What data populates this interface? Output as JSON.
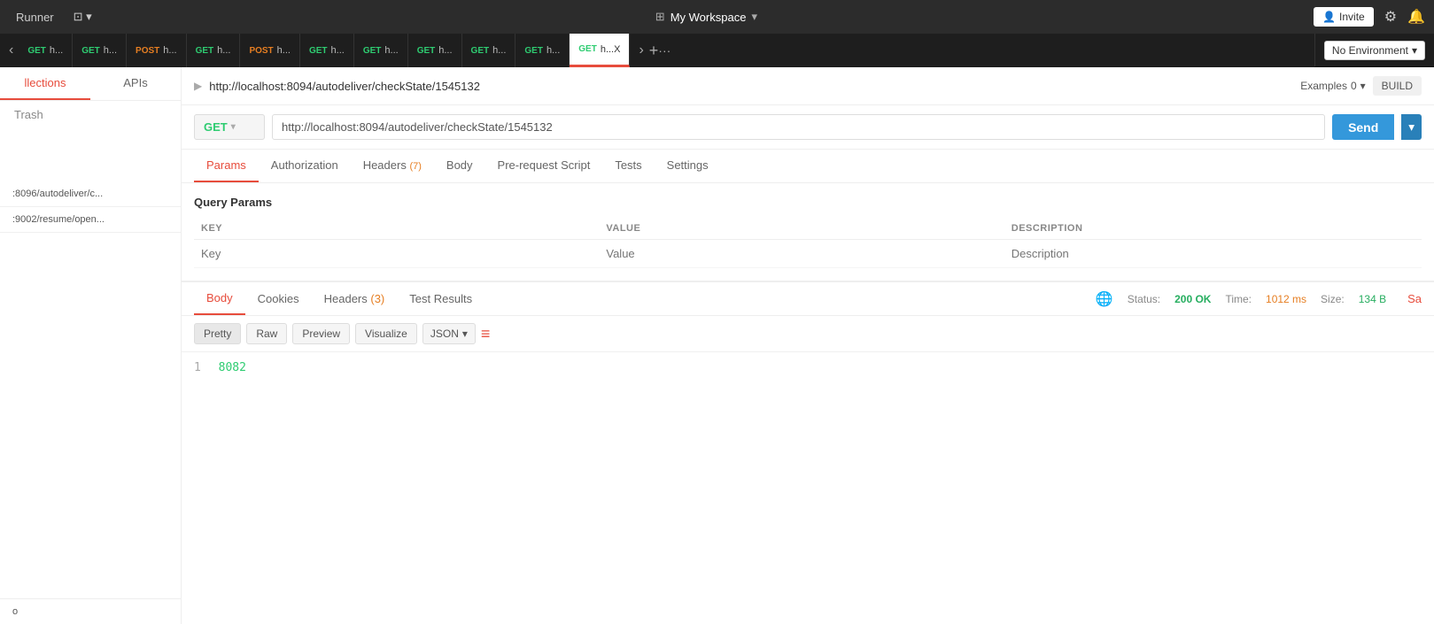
{
  "topbar": {
    "runner_label": "Runner",
    "workspace_label": "My Workspace",
    "invite_label": "Invite"
  },
  "tabbar": {
    "nav_back": "‹",
    "nav_forward": "›",
    "tabs": [
      {
        "method": "GET",
        "url": "h...",
        "active": false,
        "method_type": "get"
      },
      {
        "method": "GET",
        "url": "h...",
        "active": false,
        "method_type": "get"
      },
      {
        "method": "POST",
        "url": "h...",
        "active": false,
        "method_type": "post"
      },
      {
        "method": "GET",
        "url": "h...",
        "active": false,
        "method_type": "get"
      },
      {
        "method": "POST",
        "url": "h...",
        "active": false,
        "method_type": "post"
      },
      {
        "method": "GET",
        "url": "h...",
        "active": false,
        "method_type": "get"
      },
      {
        "method": "GET",
        "url": "h...",
        "active": false,
        "method_type": "get"
      },
      {
        "method": "GET",
        "url": "h...",
        "active": false,
        "method_type": "get"
      },
      {
        "method": "GET",
        "url": "h...",
        "active": false,
        "method_type": "get"
      },
      {
        "method": "GET",
        "url": "h...",
        "active": false,
        "method_type": "get"
      },
      {
        "method": "GET",
        "url": "h...X",
        "active": true,
        "method_type": "get"
      }
    ],
    "add_tab": "+",
    "more_tabs": "···"
  },
  "environment": {
    "label": "No Environment",
    "dropdown_icon": "▾"
  },
  "sidebar": {
    "tabs": [
      {
        "label": "llections",
        "active": true
      },
      {
        "label": "APIs",
        "active": false
      }
    ],
    "trash_label": "Trash",
    "items": [
      {
        "label": ":8096/autodeliver/c..."
      },
      {
        "label": ":9002/resume/open..."
      }
    ],
    "bottom_item": "o"
  },
  "request": {
    "url_display": "http://localhost:8094/autodeliver/checkState/1545132",
    "examples_label": "Examples",
    "examples_count": "0",
    "build_label": "BUILD",
    "method": "GET",
    "url_value": "http://localhost:8094/autodeliver/checkState/1545132",
    "send_label": "Send",
    "tabs": [
      {
        "label": "Params",
        "active": true,
        "badge": ""
      },
      {
        "label": "Authorization",
        "active": false,
        "badge": ""
      },
      {
        "label": "Headers",
        "active": false,
        "badge": "(7)"
      },
      {
        "label": "Body",
        "active": false,
        "badge": ""
      },
      {
        "label": "Pre-request Script",
        "active": false,
        "badge": ""
      },
      {
        "label": "Tests",
        "active": false,
        "badge": ""
      },
      {
        "label": "Settings",
        "active": false,
        "badge": ""
      }
    ],
    "query_params": {
      "title": "Query Params",
      "columns": [
        "KEY",
        "VALUE",
        "DESCRIPTION"
      ],
      "rows": [
        {
          "key": "",
          "value": "",
          "description": ""
        }
      ],
      "placeholders": {
        "key": "Key",
        "value": "Value",
        "description": "Description"
      }
    }
  },
  "response": {
    "tabs": [
      {
        "label": "Body",
        "active": true,
        "badge": ""
      },
      {
        "label": "Cookies",
        "active": false,
        "badge": ""
      },
      {
        "label": "Headers",
        "active": false,
        "badge": "(3)"
      },
      {
        "label": "Test Results",
        "active": false,
        "badge": ""
      }
    ],
    "status_label": "Status:",
    "status_value": "200 OK",
    "time_label": "Time:",
    "time_value": "1012 ms",
    "size_label": "Size:",
    "size_value": "134 B",
    "save_label": "Sa",
    "format_buttons": [
      "Pretty",
      "Raw",
      "Preview",
      "Visualize"
    ],
    "active_format": "Pretty",
    "json_type": "JSON",
    "content": {
      "line1_num": "1",
      "line1_value": "8082"
    }
  }
}
